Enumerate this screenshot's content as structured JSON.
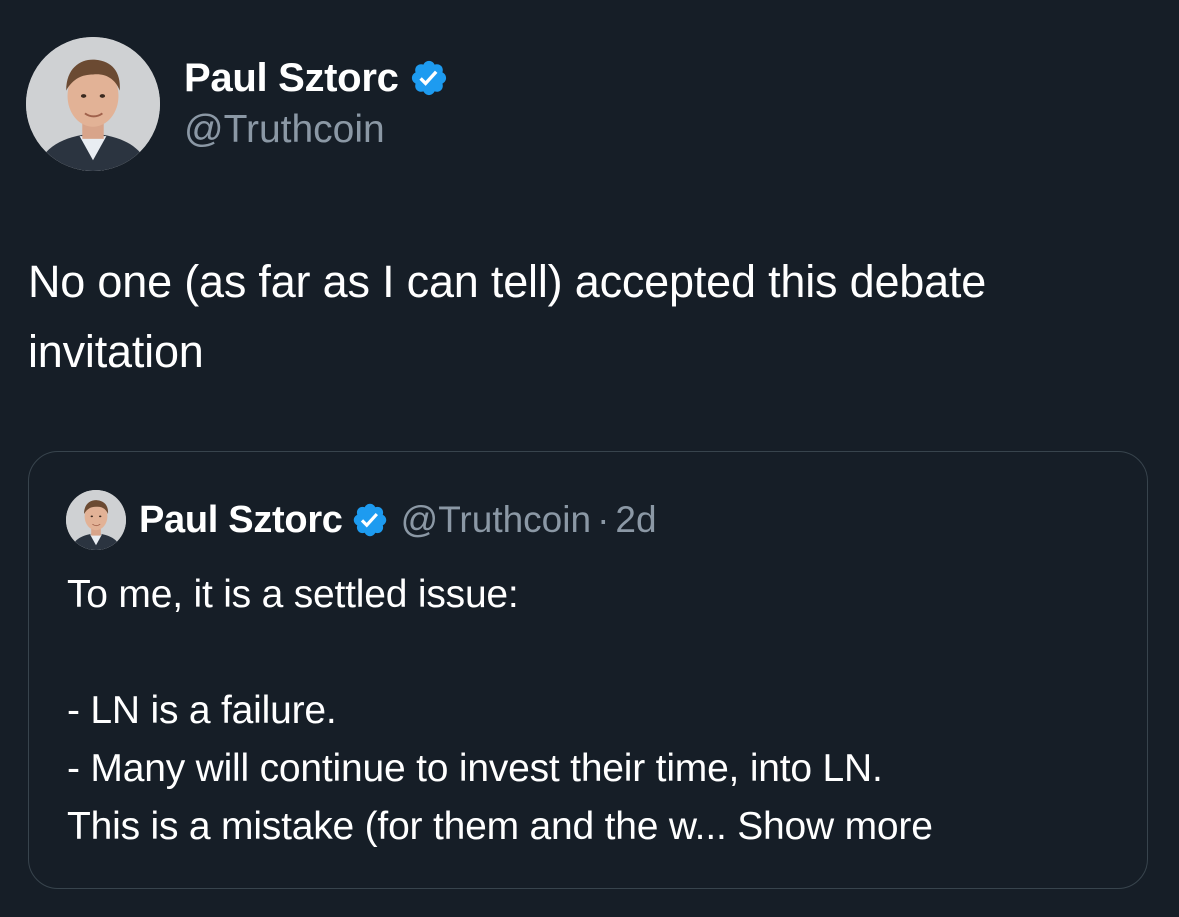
{
  "author": {
    "name": "Paul Sztorc",
    "handle": "@Truthcoin",
    "avatar_icon": "profile-photo",
    "verified_icon": "verified-badge-icon",
    "verified_color": "#1d9bf0"
  },
  "tweet": {
    "line1": "No one (as far as I can tell) accepted this debate",
    "line2": "invitation"
  },
  "quoted_tweet": {
    "name": "Paul Sztorc",
    "handle": "@Truthcoin",
    "separator": "·",
    "time": "2d",
    "lines": [
      "To me, it is a settled issue:",
      "",
      "- LN is a failure.",
      "- Many will continue to invest their time, into LN.",
      "This is a mistake (for them and the w..."
    ],
    "show_more": "Show more"
  },
  "colors": {
    "background": "#161e27",
    "text": "#ffffff",
    "secondary_text": "#8b98a5",
    "border": "#38444d"
  }
}
